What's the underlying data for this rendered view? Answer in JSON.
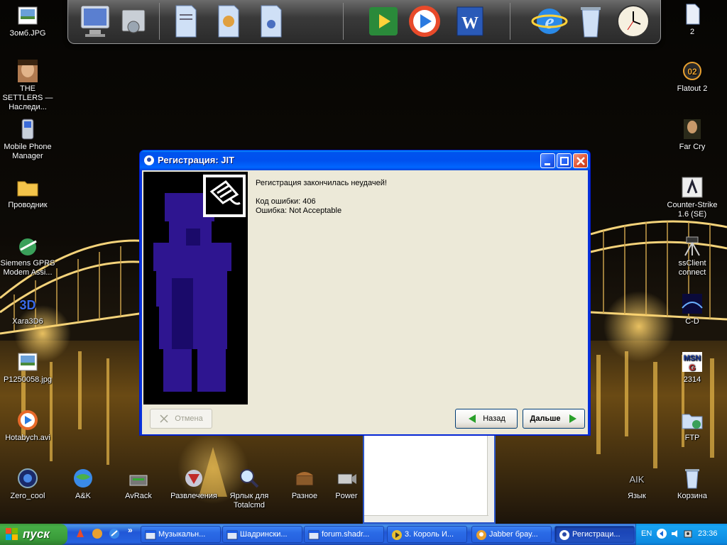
{
  "desktop": {
    "left_icons": [
      {
        "label": "Зомб.JPG"
      },
      {
        "label": "THE SETTLERS — Наследи..."
      },
      {
        "label": "Mobile Phone Manager"
      },
      {
        "label": "Проводник"
      },
      {
        "label": "Siemens GPRS Modem Assi..."
      },
      {
        "label": "Xara3D6"
      },
      {
        "label": "P1250058.jpg"
      },
      {
        "label": "Hotabych.avi"
      }
    ],
    "bottom_icons": [
      {
        "label": "Zero_cool"
      },
      {
        "label": "A&K"
      },
      {
        "label": "AvRack"
      },
      {
        "label": "Развлечения"
      },
      {
        "label": "Ярлык для Totalcmd"
      },
      {
        "label": "Разное"
      },
      {
        "label": "Power"
      }
    ],
    "right_icons": [
      {
        "label": "2"
      },
      {
        "label": "Flatout 2"
      },
      {
        "label": "Far Cry"
      },
      {
        "label": "Counter-Strike 1.6 (SE)"
      },
      {
        "label": "ssClient connect"
      },
      {
        "label": "C-D"
      },
      {
        "label": "2314"
      },
      {
        "label": "FTP"
      },
      {
        "label": "Язык"
      },
      {
        "label": "Корзина"
      }
    ],
    "msn_badge": "MSN",
    "aik_badge": "AIK"
  },
  "dock": {
    "items": [
      "monitor-icon",
      "network-share-icon",
      "documents-folder-icon",
      "pictures-folder-icon",
      "music-folder-icon",
      "media-center-icon",
      "media-player-icon",
      "word-icon",
      "internet-explorer-icon",
      "recycle-bin-icon",
      "clock-icon"
    ]
  },
  "dialog": {
    "title": "Регистрация: JIT",
    "message_line1": "Регистрация закончилась неудачей!",
    "error_code": "Код ошибки: 406",
    "error_text": "Ошибка: Not Acceptable",
    "cancel_label": "Отмена",
    "back_label": "Назад",
    "next_label": "Дальше"
  },
  "taskbar": {
    "start_label": "пуск",
    "tasks": [
      {
        "label": "Музыкальн..."
      },
      {
        "label": "Шадрински..."
      },
      {
        "label": "forum.shadr..."
      },
      {
        "label": "3. Король И..."
      },
      {
        "label": "Jabber брау..."
      },
      {
        "label": "Регистраци..."
      }
    ],
    "quicklaunch_more": "»",
    "lang": "EN",
    "clock": "23:36"
  },
  "colors": {
    "xp_blue": "#0054e3",
    "dialog_face": "#ece9d8",
    "start_green": "#3a9d3a",
    "art_purple": "#2a0a8a"
  }
}
